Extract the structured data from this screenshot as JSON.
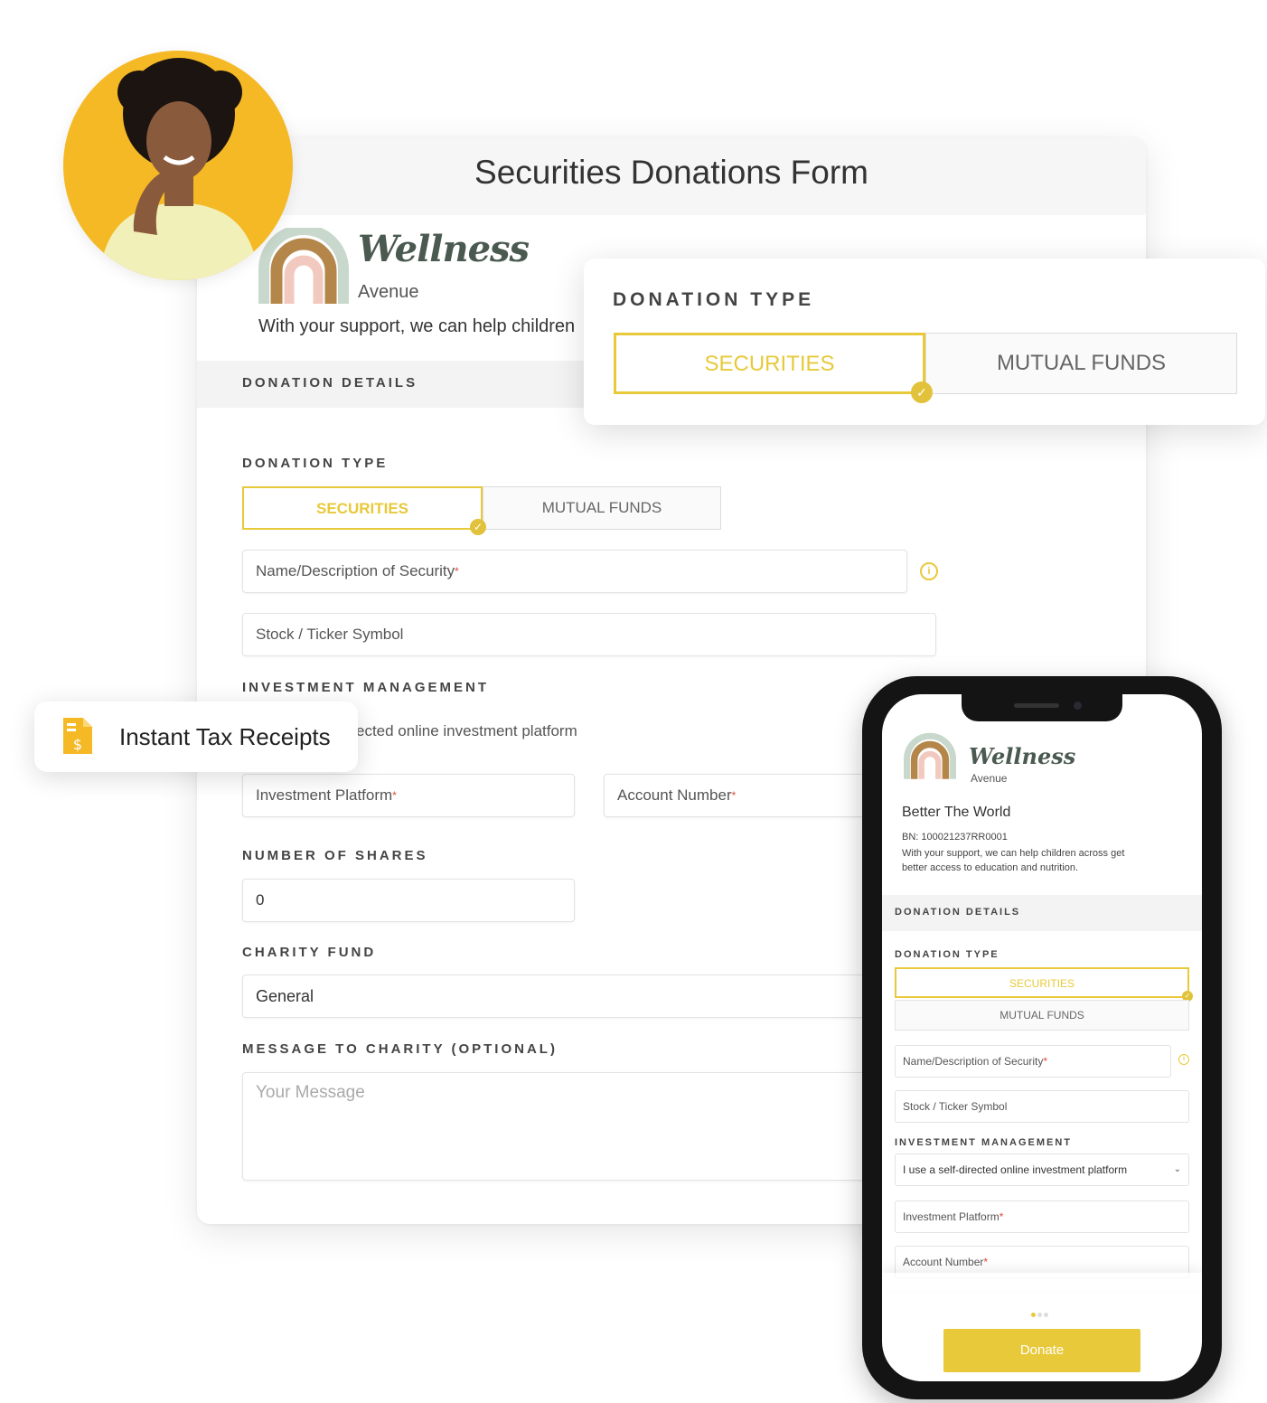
{
  "form": {
    "title": "Securities Donations Form",
    "brand_name": "Wellness",
    "brand_sub": "Avenue",
    "tagline": "With your support, we can help children",
    "section_title": "DONATION DETAILS",
    "donation_type_label": "DONATION TYPE",
    "securities_label": "SECURITIES",
    "mutual_funds_label": "MUTUAL FUNDS",
    "security_name_placeholder": "Name/Description of Security",
    "ticker_placeholder": "Stock / Ticker Symbol",
    "investment_mgmt_label": "INVESTMENT MANAGEMENT",
    "investment_mgmt_value": "ected online investment platform",
    "investment_platform_placeholder": "Investment Platform",
    "account_number_placeholder": "Account Number",
    "shares_label": "NUMBER OF SHARES",
    "shares_value": "0",
    "charity_fund_label": "CHARITY FUND",
    "charity_fund_value": "General",
    "message_label": "MESSAGE TO CHARITY (OPTIONAL)",
    "message_placeholder": "Your Message"
  },
  "popup": {
    "label": "DONATION TYPE",
    "securities_label": "SECURITIES",
    "mutual_funds_label": "MUTUAL FUNDS"
  },
  "badge": {
    "text": "Instant Tax Receipts"
  },
  "phone": {
    "brand_name": "Wellness",
    "brand_sub": "Avenue",
    "org_name": "Better The World",
    "bn": "BN: 100021237RR0001",
    "description_line1": "With your support, we can help children across get",
    "description_line2": "better access to education and nutrition.",
    "section_title": "DONATION DETAILS",
    "donation_type_label": "DONATION TYPE",
    "securities_label": "SECURITIES",
    "mutual_funds_label": "MUTUAL FUNDS",
    "security_name_placeholder": "Name/Description of Security",
    "ticker_placeholder": "Stock / Ticker Symbol",
    "investment_mgmt_label": "INVESTMENT MANAGEMENT",
    "investment_mgmt_value": "I use a self-directed online investment platform",
    "investment_platform_placeholder": "Investment Platform",
    "account_number_placeholder": "Account Number",
    "donate_label": "Donate"
  },
  "colors": {
    "accent": "#e8c93a",
    "avatar_bg": "#f5b926",
    "required": "#e04a3a"
  }
}
